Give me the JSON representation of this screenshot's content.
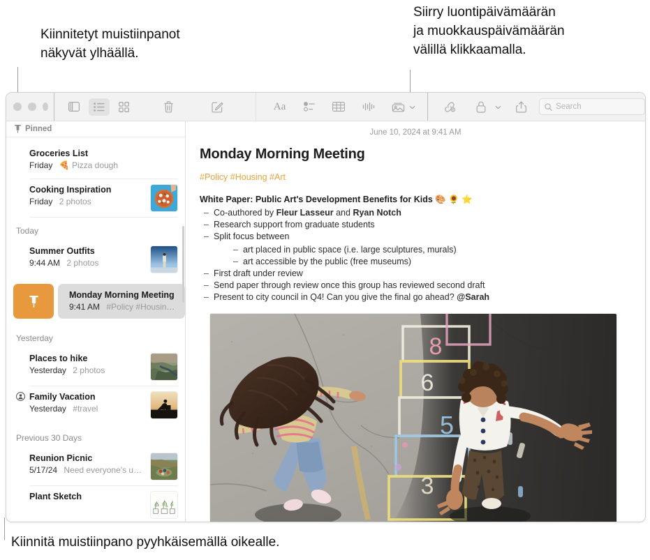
{
  "callouts": {
    "pinned_top": "Kiinnitetyt muistiinpanot\nnäkyvät ylhäällä.",
    "dates": "Siirry luontipäivämäärän\nja muokkauspäivämäärän\nvälillä klikkaamalla.",
    "swipe": "Kiinnitä muistiinpano pyyhkäisemällä oikealle."
  },
  "toolbar": {
    "sidebar_toggle": "sidebar-toggle",
    "list_view": "list-view",
    "gallery_view": "gallery-view",
    "delete": "delete-note",
    "compose": "new-note",
    "format": "Aa",
    "checklist": "checklist",
    "table": "table",
    "audio": "audio",
    "media": "media",
    "collaborate": "collaborate",
    "lock": "lock",
    "share": "share",
    "search_placeholder": "Search",
    "search_value": ""
  },
  "sidebar": {
    "pinned_label": "Pinned",
    "sections": [
      {
        "title": "",
        "notes": [
          {
            "title": "Groceries List",
            "date": "Friday",
            "snippet": "🍕 Pizza dough",
            "thumb": "none",
            "shared": false
          },
          {
            "title": "Cooking Inspiration",
            "date": "Friday",
            "snippet": "2 photos",
            "thumb": "pizza",
            "shared": false
          }
        ]
      },
      {
        "title": "Today",
        "notes": [
          {
            "title": "Summer Outfits",
            "date": "9:44 AM",
            "snippet": "2 photos",
            "thumb": "outfit",
            "shared": false
          }
        ]
      },
      {
        "title": "Yesterday",
        "notes": [
          {
            "title": "Places to hike",
            "date": "Yesterday",
            "snippet": "2 photos",
            "thumb": "hike",
            "shared": false
          },
          {
            "title": "Family Vacation",
            "date": "Yesterday",
            "snippet": "#travel",
            "thumb": "vacation",
            "shared": true
          }
        ]
      },
      {
        "title": "Previous 30 Days",
        "notes": [
          {
            "title": "Reunion Picnic",
            "date": "5/17/24",
            "snippet": "Need everyone's u…",
            "thumb": "picnic",
            "shared": false
          },
          {
            "title": "Plant Sketch",
            "date": "",
            "snippet": "",
            "thumb": "plant",
            "shared": false
          }
        ]
      }
    ],
    "selected_note": {
      "title": "Monday Morning Meeting",
      "date": "9:41 AM",
      "snippet": "#Policy #Housing…",
      "pin_action_label": "Pin"
    }
  },
  "note": {
    "date_header": "June 10, 2024 at 9:41 AM",
    "title": "Monday Morning Meeting",
    "tags": "#Policy #Housing #Art",
    "lead": "White Paper: Public Art's Development Benefits for Kids 🎨 🌻 ⭐",
    "bullets": [
      {
        "prefix": "Co-authored by ",
        "bold1": "Fleur Lasseur",
        "mid": " and ",
        "bold2": "Ryan Notch",
        "suffix": ""
      },
      {
        "prefix": "Research support from graduate students"
      },
      {
        "prefix": "Split focus between",
        "children": [
          "art placed in public space (i.e. large sculptures, murals)",
          "art accessible by the public (free museums)"
        ]
      },
      {
        "prefix": "First draft under review"
      },
      {
        "prefix": "Send paper through review once this group has reviewed second draft"
      },
      {
        "prefix": "Present to city council in Q4! Can you give the final go ahead? ",
        "bold1": "@Sarah"
      }
    ],
    "photo_alt": "Two children playing hopscotch drawn in chalk on asphalt"
  },
  "colors": {
    "accent_orange": "#E8983D",
    "tag_yellow": "#E8A33D",
    "toolbar_bg": "#f2f2f2",
    "selection_gray": "#dcdcdc"
  }
}
